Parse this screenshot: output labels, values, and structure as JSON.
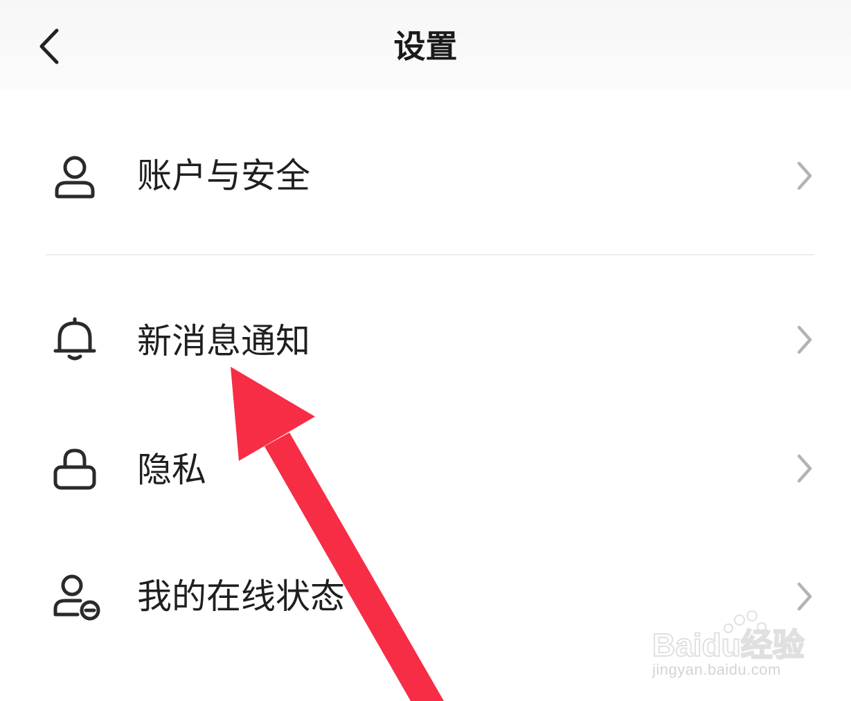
{
  "header": {
    "title": "设置"
  },
  "settings": {
    "items": [
      {
        "label": "账户与安全",
        "icon": "user-icon"
      },
      {
        "label": "新消息通知",
        "icon": "bell-icon"
      },
      {
        "label": "隐私",
        "icon": "lock-icon"
      },
      {
        "label": "我的在线状态",
        "icon": "user-status-icon"
      }
    ]
  },
  "watermark": {
    "brand": "Baidu经验",
    "url": "jingyan.baidu.com"
  },
  "colors": {
    "annotation_arrow": "#f72d45",
    "text": "#1f1f1f",
    "chevron": "#b3b3b3"
  }
}
